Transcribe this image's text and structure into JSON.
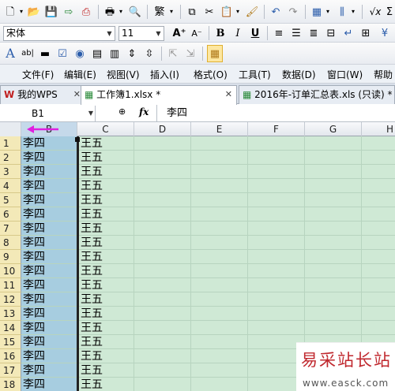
{
  "toolbar_font": {
    "font_name": "宋体",
    "font_size": "11"
  },
  "menu": [
    "文件(F)",
    "编辑(E)",
    "视图(V)",
    "插入(I)",
    "格式(O)",
    "工具(T)",
    "数据(D)",
    "窗口(W)",
    "帮助"
  ],
  "tabs": [
    {
      "label": "我的WPS",
      "active": false
    },
    {
      "label": "工作簿1.xlsx *",
      "active": true
    },
    {
      "label": "2016年-订单汇总表.xls (只读) *",
      "active": false
    }
  ],
  "formula_bar": {
    "cell_ref": "B1",
    "fx_label": "fx",
    "content": "李四"
  },
  "columns": [
    "B",
    "C",
    "D",
    "E",
    "F",
    "G",
    "H"
  ],
  "rows": [
    {
      "n": "1",
      "b": "李四",
      "c": "王五"
    },
    {
      "n": "2",
      "b": "李四",
      "c": "王五"
    },
    {
      "n": "3",
      "b": "李四",
      "c": "王五"
    },
    {
      "n": "4",
      "b": "李四",
      "c": "王五"
    },
    {
      "n": "5",
      "b": "李四",
      "c": "王五"
    },
    {
      "n": "6",
      "b": "李四",
      "c": "王五"
    },
    {
      "n": "7",
      "b": "李四",
      "c": "王五"
    },
    {
      "n": "8",
      "b": "李四",
      "c": "王五"
    },
    {
      "n": "9",
      "b": "李四",
      "c": "王五"
    },
    {
      "n": "10",
      "b": "李四",
      "c": "王五"
    },
    {
      "n": "11",
      "b": "李四",
      "c": "王五"
    },
    {
      "n": "12",
      "b": "李四",
      "c": "王五"
    },
    {
      "n": "13",
      "b": "李四",
      "c": "王五"
    },
    {
      "n": "14",
      "b": "李四",
      "c": "王五"
    },
    {
      "n": "15",
      "b": "李四",
      "c": "王五"
    },
    {
      "n": "16",
      "b": "李四",
      "c": "王五"
    },
    {
      "n": "17",
      "b": "李四",
      "c": "王五"
    },
    {
      "n": "18",
      "b": "李四",
      "c": "王五"
    }
  ],
  "watermark": {
    "cn": "易采站长站",
    "en": "www.easck.com"
  },
  "colors": {
    "selected_column": "#a7cde0",
    "grid_background": "#cfe9d5",
    "row_header": "#f3e9b8",
    "arrow": "#e020e0",
    "watermark_red": "#c0282e"
  }
}
